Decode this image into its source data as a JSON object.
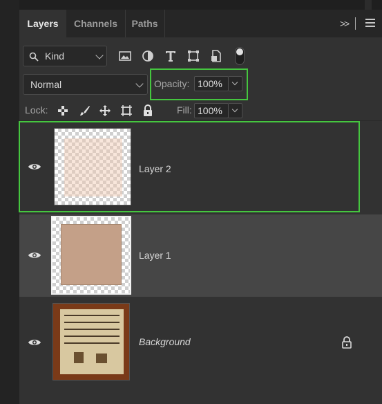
{
  "tabs": [
    {
      "label": "Layers",
      "active": true
    },
    {
      "label": "Channels",
      "active": false
    },
    {
      "label": "Paths",
      "active": false
    }
  ],
  "panel_menu": {
    "more_label": ">>"
  },
  "filter": {
    "kind_label": "Kind",
    "icons": [
      "image-filter-icon",
      "adjustment-filter-icon",
      "type-filter-icon",
      "shape-filter-icon",
      "smart-object-filter-icon"
    ]
  },
  "blend": {
    "mode": "Normal"
  },
  "opacity": {
    "label": "Opacity:",
    "value": "100%"
  },
  "lock": {
    "label": "Lock:",
    "icons": [
      "lock-transparent-pixels-icon",
      "lock-image-pixels-icon",
      "lock-position-icon",
      "lock-artboard-icon",
      "lock-all-icon"
    ]
  },
  "fill": {
    "label": "Fill:",
    "value": "100%"
  },
  "layers": [
    {
      "name": "Layer 2",
      "visible": true,
      "locked": false,
      "selected": false
    },
    {
      "name": "Layer 1",
      "visible": true,
      "locked": false,
      "selected": true
    },
    {
      "name": "Background",
      "visible": true,
      "locked": true,
      "selected": false
    }
  ],
  "colors": {
    "highlight": "#45c63f",
    "panel": "#323232",
    "selected_row": "#464646"
  }
}
